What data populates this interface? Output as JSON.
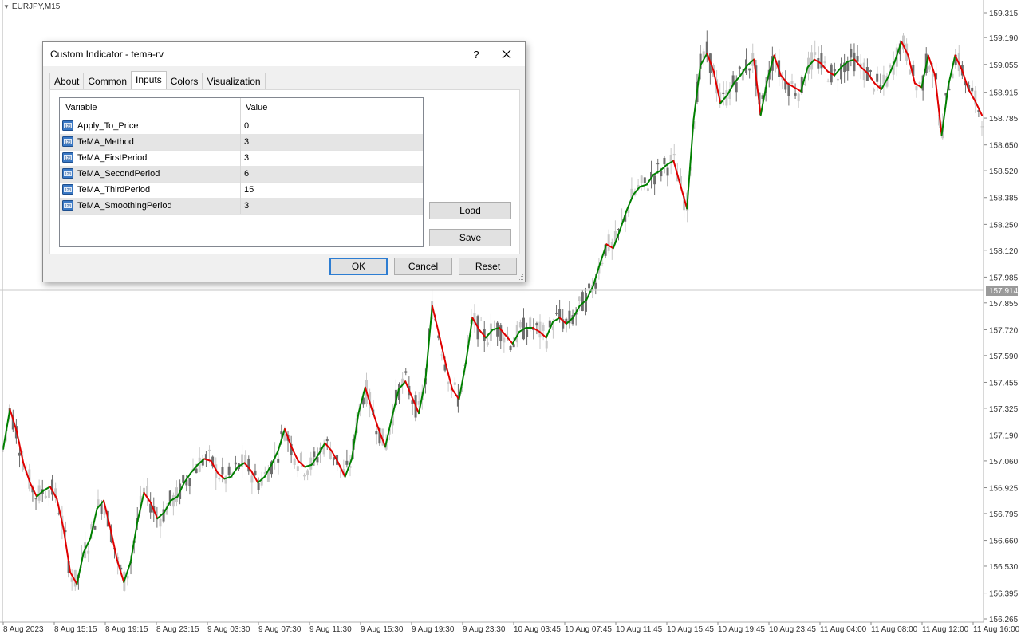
{
  "chart": {
    "symbol": "EURJPY,M15",
    "current_price": "157.914",
    "colors": {
      "up": "#008000",
      "down": "#e00000",
      "candle_bull": "#c8c8c8",
      "candle_bear": "#6e6e6e",
      "grid": "#e6e6e6",
      "background": "#ffffff"
    },
    "price_levels": [
      "159.315",
      "159.190",
      "159.055",
      "158.915",
      "158.785",
      "158.650",
      "158.520",
      "158.385",
      "158.250",
      "158.120",
      "157.985",
      "157.855",
      "157.720",
      "157.590",
      "157.455",
      "157.325",
      "157.190",
      "157.060",
      "156.925",
      "156.795",
      "156.660",
      "156.530",
      "156.395",
      "156.265"
    ],
    "time_labels": [
      "8 Aug 2023",
      "8 Aug 15:15",
      "8 Aug 19:15",
      "8 Aug 23:15",
      "9 Aug 03:30",
      "9 Aug 07:30",
      "9 Aug 11:30",
      "9 Aug 15:30",
      "9 Aug 19:30",
      "9 Aug 23:30",
      "10 Aug 03:45",
      "10 Aug 07:45",
      "10 Aug 11:45",
      "10 Aug 15:45",
      "10 Aug 19:45",
      "10 Aug 23:45",
      "11 Aug 04:00",
      "11 Aug 08:00",
      "11 Aug 12:00",
      "11 Aug 16:00"
    ],
    "tema_close_path": [
      157.12,
      157.32,
      157.21,
      157.05,
      156.95,
      156.88,
      156.91,
      156.93,
      156.87,
      156.72,
      156.5,
      156.44,
      156.6,
      156.67,
      156.82,
      156.86,
      156.72,
      156.56,
      156.45,
      156.55,
      156.75,
      156.9,
      156.85,
      156.77,
      156.8,
      156.86,
      156.88,
      156.95,
      157.0,
      157.04,
      157.07,
      157.06,
      157.0,
      156.97,
      156.98,
      157.03,
      157.05,
      157.01,
      156.95,
      156.98,
      157.04,
      157.11,
      157.22,
      157.13,
      157.06,
      157.03,
      157.04,
      157.09,
      157.15,
      157.11,
      157.05,
      156.98,
      157.07,
      157.3,
      157.43,
      157.32,
      157.22,
      157.13,
      157.28,
      157.42,
      157.46,
      157.38,
      157.3,
      157.47,
      157.84,
      157.7,
      157.55,
      157.42,
      157.37,
      157.55,
      157.78,
      157.72,
      157.68,
      157.72,
      157.73,
      157.69,
      157.65,
      157.71,
      157.73,
      157.73,
      157.71,
      157.68,
      157.76,
      157.78,
      157.75,
      157.78,
      157.84,
      157.87,
      157.94,
      158.05,
      158.15,
      158.13,
      158.22,
      158.32,
      158.4,
      158.44,
      158.45,
      158.5,
      158.52,
      158.55,
      158.57,
      158.45,
      158.33,
      158.78,
      159.05,
      159.11,
      159.02,
      158.86,
      158.9,
      158.96,
      159.0,
      159.05,
      159.08,
      158.8,
      158.98,
      159.1,
      159.0,
      158.96,
      158.94,
      158.92,
      159.04,
      159.08,
      159.06,
      159.02,
      159.0,
      159.04,
      159.07,
      159.08,
      159.04,
      159.01,
      158.96,
      158.93,
      158.99,
      159.07,
      159.17,
      159.1,
      158.96,
      158.94,
      159.1,
      159.0,
      158.7,
      158.95,
      159.1,
      159.03,
      158.93,
      158.87,
      158.8
    ],
    "candle_seed": 7
  },
  "dialog": {
    "title": "Custom Indicator - tema-rv",
    "help_label": "?",
    "tabs": [
      "About",
      "Common",
      "Inputs",
      "Colors",
      "Visualization"
    ],
    "active_tab": "Inputs",
    "columns": {
      "variable": "Variable",
      "value": "Value"
    },
    "inputs": [
      {
        "name": "Apply_To_Price",
        "value": "0"
      },
      {
        "name": "TeMA_Method",
        "value": "3"
      },
      {
        "name": "TeMA_FirstPeriod",
        "value": "3"
      },
      {
        "name": "TeMA_SecondPeriod",
        "value": "6"
      },
      {
        "name": "TeMA_ThirdPeriod",
        "value": "15"
      },
      {
        "name": "TeMA_SmoothingPeriod",
        "value": "3"
      }
    ],
    "icon_text": "123",
    "load_label": "Load",
    "save_label": "Save",
    "ok_label": "OK",
    "cancel_label": "Cancel",
    "reset_label": "Reset"
  }
}
